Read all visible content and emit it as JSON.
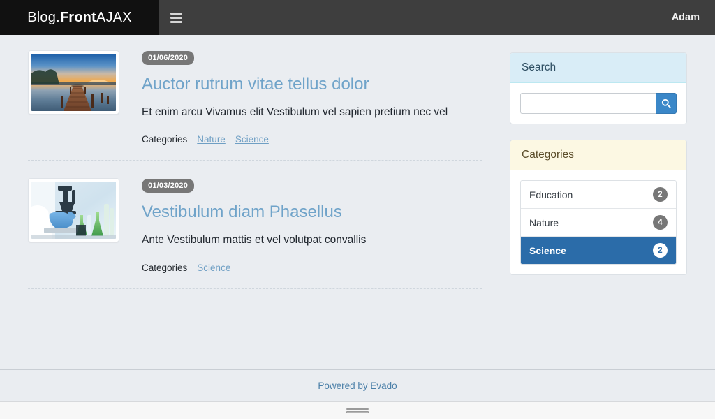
{
  "navbar": {
    "brand_light_1": "Blog.",
    "brand_bold": "Front",
    "brand_light_2": " AJAX",
    "toggle_icon": "hamburger-menu-icon",
    "user": "Adam"
  },
  "posts": [
    {
      "date": "01/06/2020",
      "title": "Auctor rutrum vitae tellus dolor",
      "excerpt": "Et enim arcu Vivamus elit Vestibulum vel sapien pretium nec vel",
      "categories_label": "Categories",
      "categories": [
        "Nature",
        "Science"
      ],
      "thumb_alt": "wooden-pier-lake-sunset"
    },
    {
      "date": "01/03/2020",
      "title": "Vestibulum diam Phasellus",
      "excerpt": "Ante Vestibulum mattis et vel volutpat convallis",
      "categories_label": "Categories",
      "categories": [
        "Science"
      ],
      "thumb_alt": "laboratory-microscope-flasks"
    }
  ],
  "sidebar": {
    "search": {
      "title": "Search",
      "value": "",
      "placeholder": "",
      "button_icon": "search-icon"
    },
    "categories": {
      "title": "Categories",
      "items": [
        {
          "label": "Education",
          "count": "2",
          "active": false
        },
        {
          "label": "Nature",
          "count": "4",
          "active": false
        },
        {
          "label": "Science",
          "count": "2",
          "active": true
        }
      ]
    }
  },
  "footer": {
    "powered_by": "Powered by Evado"
  },
  "colors": {
    "brand_bg": "#111111",
    "navbar_bg": "#3e3e3e",
    "page_bg": "#eaedf1",
    "title_link": "#6fa3c9",
    "accent_blue": "#3a87c8",
    "active_blue": "#2b6ca9",
    "badge_gray": "#777777",
    "panel_info_head": "#d9edf7",
    "panel_warning_head": "#fcf8e3"
  }
}
